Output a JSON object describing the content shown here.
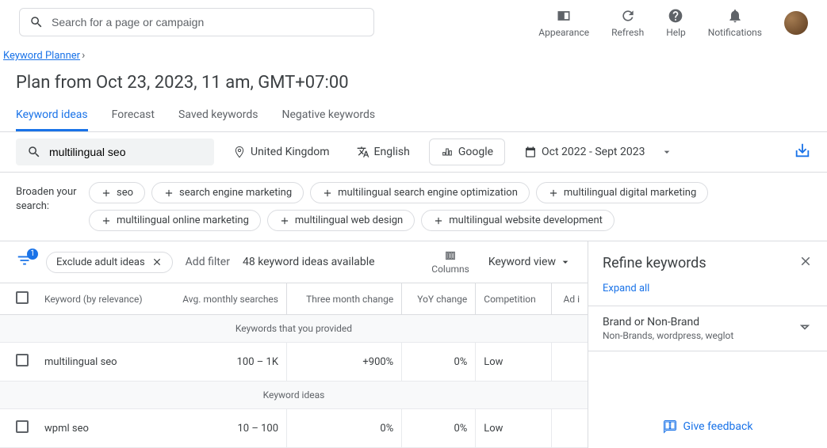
{
  "search": {
    "placeholder": "Search for a page or campaign"
  },
  "topIcons": {
    "appearance": "Appearance",
    "refresh": "Refresh",
    "help": "Help",
    "notifications": "Notifications"
  },
  "breadcrumb": {
    "label": "Keyword Planner"
  },
  "pageTitle": "Plan from Oct 23, 2023, 11 am, GMT+07:00",
  "tabs": [
    "Keyword ideas",
    "Forecast",
    "Saved keywords",
    "Negative keywords"
  ],
  "activeTab": 0,
  "keywordInput": {
    "value": "multilingual seo"
  },
  "filters": {
    "location": "United Kingdom",
    "language": "English",
    "network": "Google",
    "dateRange": "Oct 2022 - Sept 2023"
  },
  "broaden": {
    "label": "Broaden your search:",
    "chips": [
      "seo",
      "search engine marketing",
      "multilingual search engine optimization",
      "multilingual digital marketing",
      "multilingual online marketing",
      "multilingual web design",
      "multilingual website development"
    ]
  },
  "toolbar": {
    "filterBadge": "1",
    "excludeChip": "Exclude adult ideas",
    "addFilter": "Add filter",
    "available": "48 keyword ideas available",
    "columns": "Columns",
    "view": "Keyword view"
  },
  "columns": [
    "",
    "Keyword (by relevance)",
    "Avg. monthly searches",
    "Three month change",
    "YoY change",
    "Competition",
    "Ad i"
  ],
  "sections": [
    {
      "title": "Keywords that you provided",
      "rows": [
        {
          "keyword": "multilingual seo",
          "avg": "100 – 1K",
          "three": "+900%",
          "yoy": "0%",
          "comp": "Low"
        }
      ]
    },
    {
      "title": "Keyword ideas",
      "rows": [
        {
          "keyword": "wpml seo",
          "avg": "10 – 100",
          "three": "0%",
          "yoy": "0%",
          "comp": "Low"
        }
      ]
    }
  ],
  "refine": {
    "title": "Refine keywords",
    "expandAll": "Expand all",
    "group": {
      "title": "Brand or Non-Brand",
      "sub": "Non-Brands, wordpress, weglot"
    },
    "feedback": "Give feedback"
  }
}
